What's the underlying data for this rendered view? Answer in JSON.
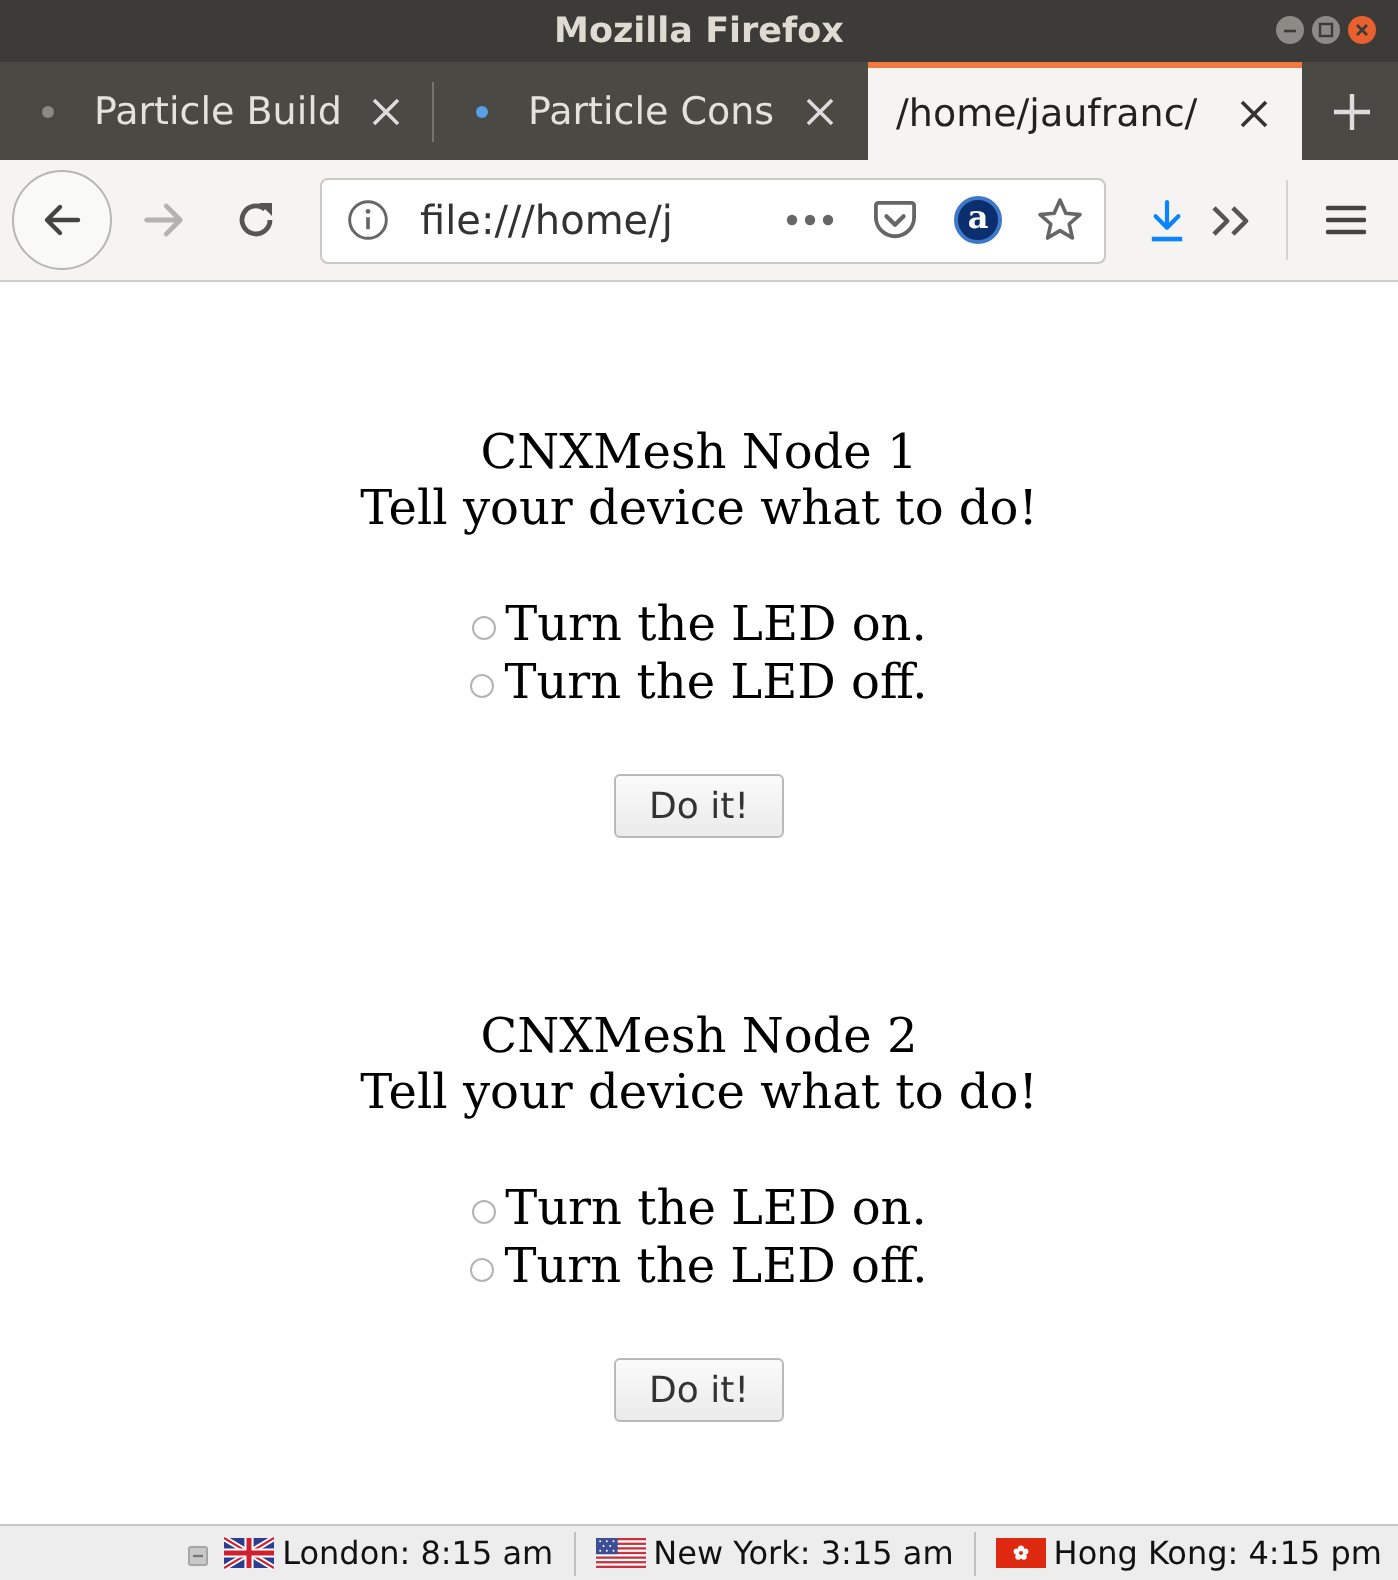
{
  "window": {
    "title": "Mozilla Firefox"
  },
  "tabs": [
    {
      "label": "Particle Build",
      "selected": false,
      "color": "#8a8882"
    },
    {
      "label": "Particle Cons",
      "selected": false,
      "color": "#5aa0e6"
    },
    {
      "label": "/home/jaufranc/",
      "selected": true
    }
  ],
  "toolbar": {
    "forward_disabled": true,
    "url": "file:///home/j",
    "extension_label": "a"
  },
  "nodes": [
    {
      "title": "CNXMesh Node 1",
      "prompt": "Tell your device what to do!",
      "options": [
        {
          "label": "Turn the LED on.",
          "selected": false
        },
        {
          "label": "Turn the LED off.",
          "selected": false
        }
      ],
      "button": "Do it!"
    },
    {
      "title": "CNXMesh Node 2",
      "prompt": "Tell your device what to do!",
      "options": [
        {
          "label": "Turn the LED on.",
          "selected": false
        },
        {
          "label": "Turn the LED off.",
          "selected": false
        }
      ],
      "button": "Do it!"
    }
  ],
  "status_bar": {
    "clocks": [
      {
        "kind": "uk",
        "label": "London: 8:15 am"
      },
      {
        "kind": "us",
        "label": "New York: 3:15 am"
      },
      {
        "kind": "hk",
        "label": "Hong Kong: 4:15 pm"
      }
    ]
  }
}
